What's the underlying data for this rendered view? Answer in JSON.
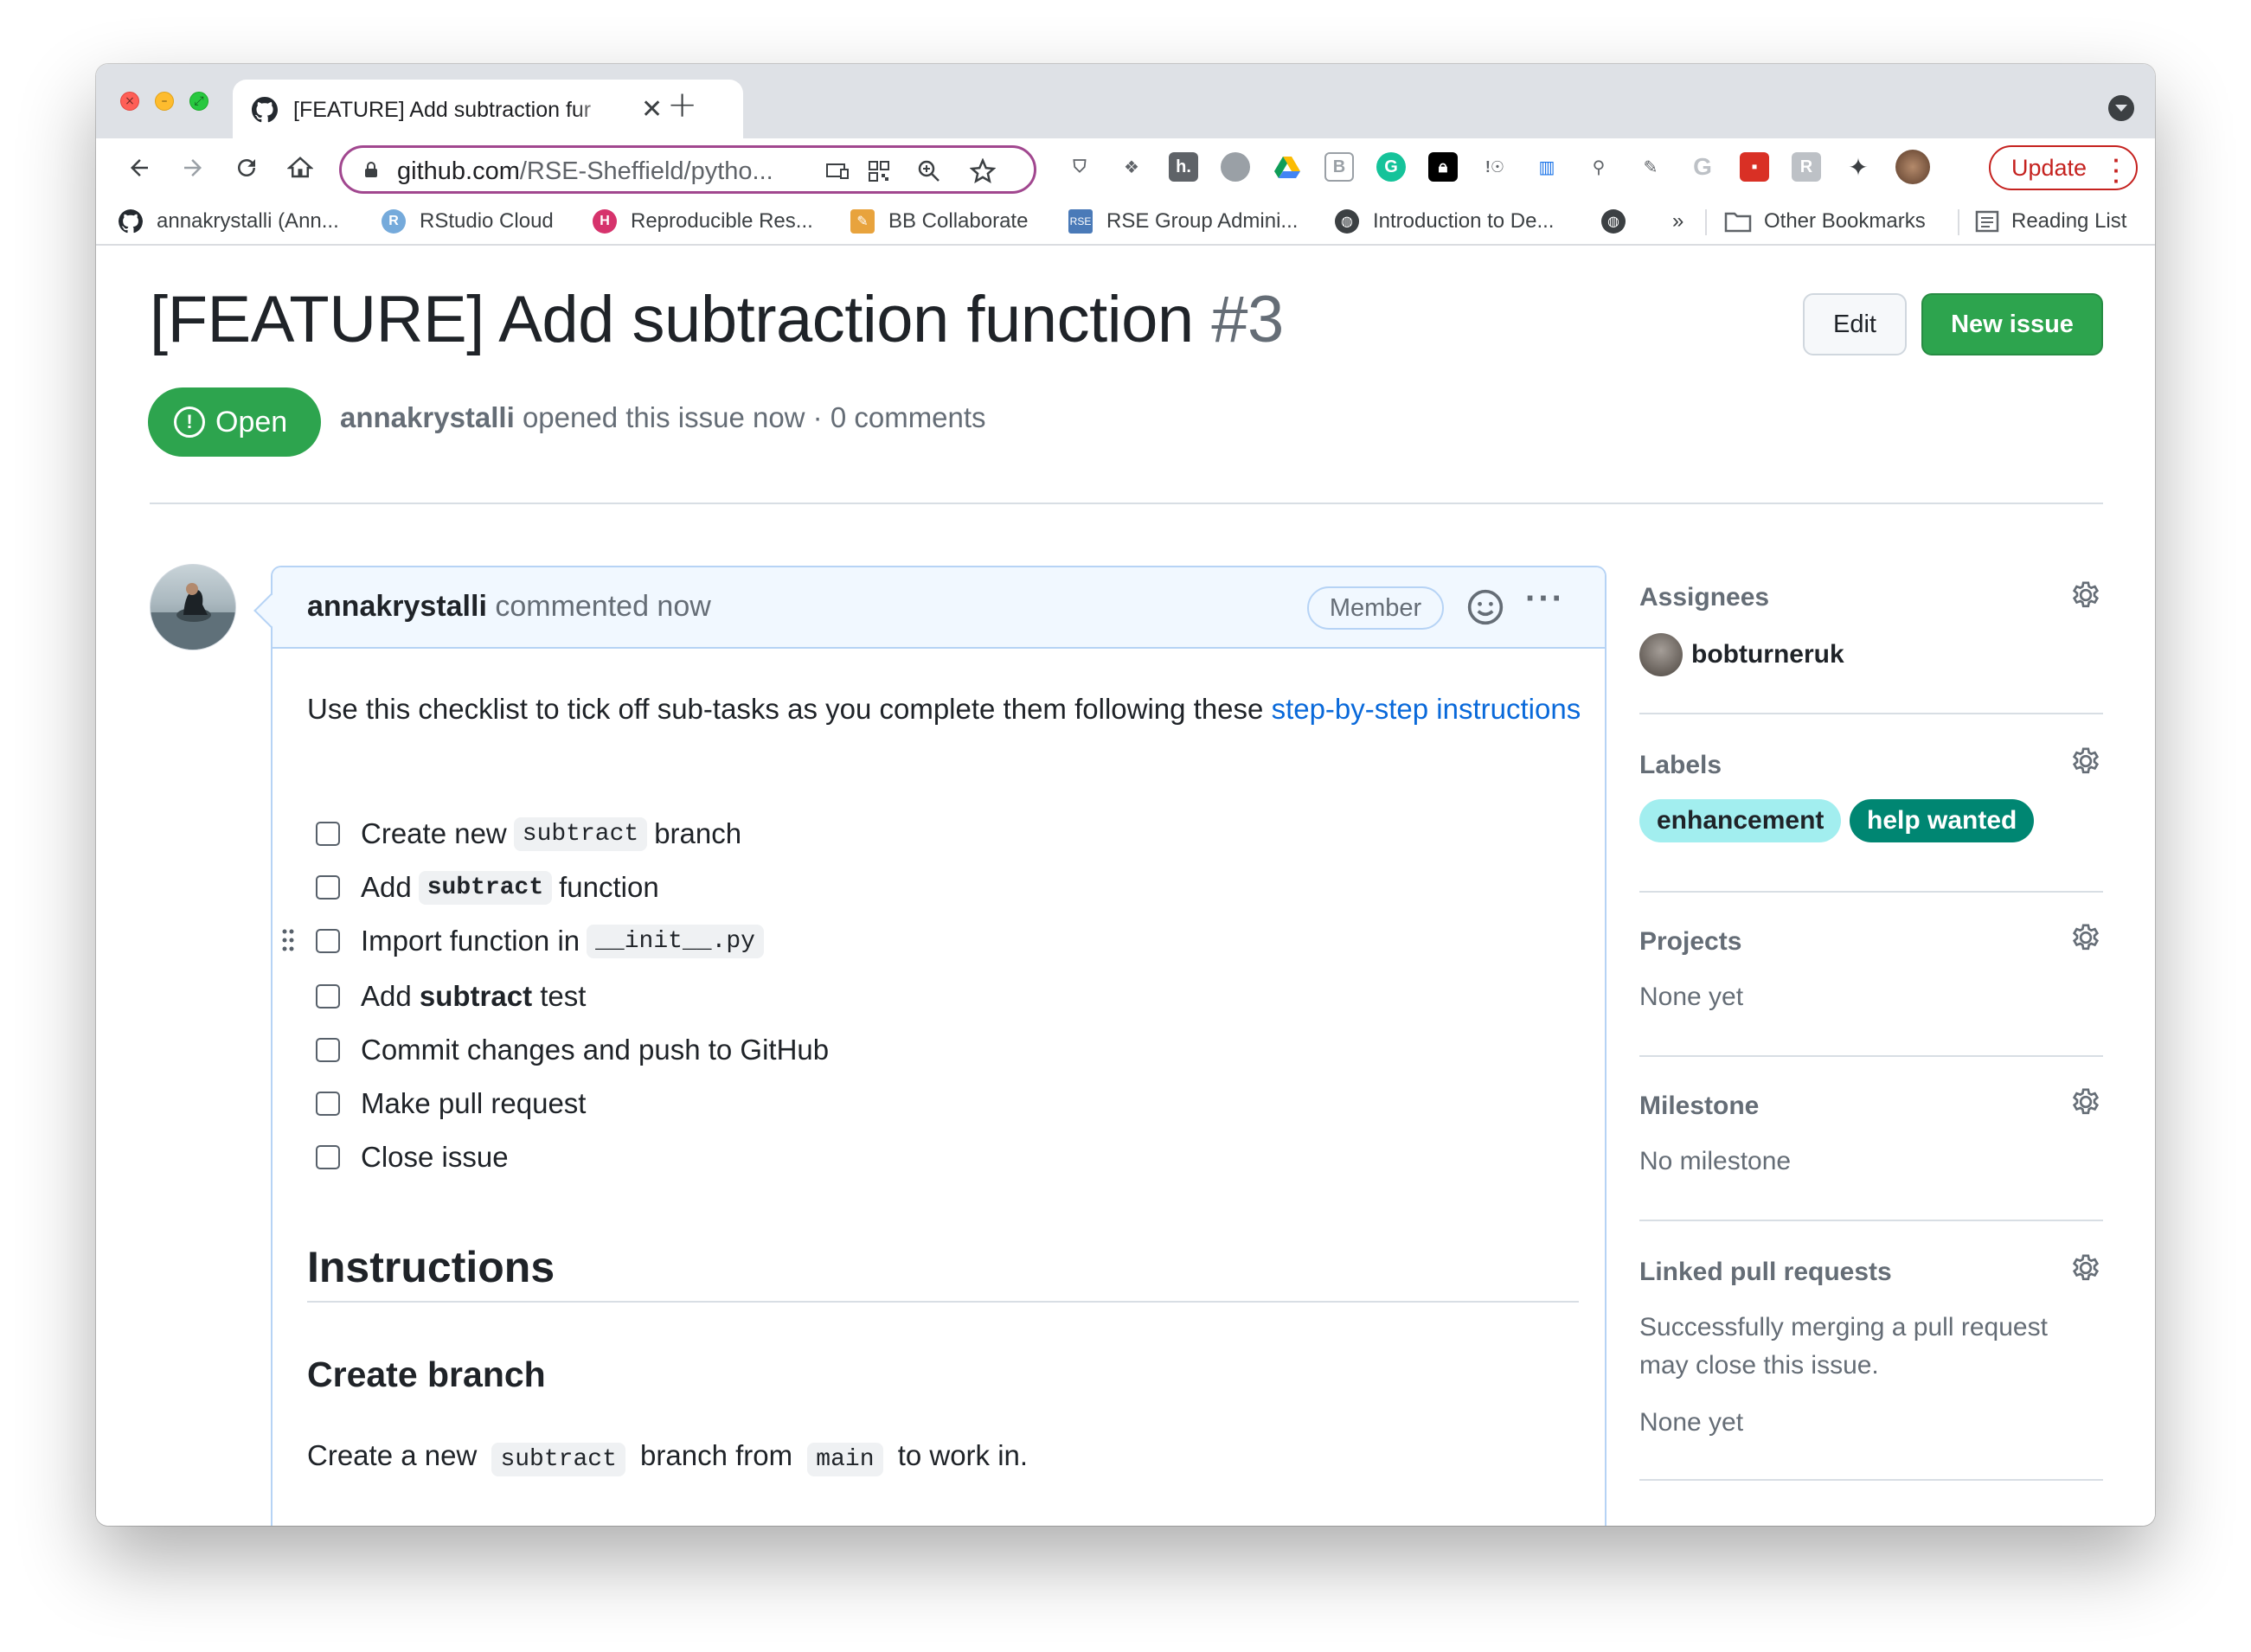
{
  "browser": {
    "tab_title": "[FEATURE] Add subtraction fur",
    "tab_close": "✕",
    "new_tab": "+",
    "url_host": "github.com",
    "url_path": "/RSE-Sheffield/pytho...",
    "update_label": "Update",
    "bookmarks": [
      {
        "label": "annakrystalli (Ann...",
        "icon": "github-icon"
      },
      {
        "label": "RStudio Cloud",
        "icon": "rstudio-icon"
      },
      {
        "label": "Reproducible Res...",
        "icon": "hexagon-icon"
      },
      {
        "label": "BB Collaborate",
        "icon": "pencil-icon"
      },
      {
        "label": "RSE Group Admini...",
        "icon": "rse-icon"
      },
      {
        "label": "Introduction to De...",
        "icon": "globe-icon"
      }
    ],
    "bookmarks_overflow": "»",
    "other_bookmarks": "Other Bookmarks",
    "reading_list": "Reading List",
    "accent_color": "#a1478f"
  },
  "issue": {
    "title": "[FEATURE] Add subtraction function",
    "number": "#3",
    "edit_label": "Edit",
    "new_issue_label": "New issue",
    "state": "Open",
    "author": "annakrystalli",
    "meta_text": "opened this issue now · 0 comments",
    "green": "#2da44e"
  },
  "comment": {
    "author": "annakrystalli",
    "time": "commented now",
    "role": "Member",
    "more": "···",
    "intro": "Use this checklist to tick off sub-tasks as you complete them following these ",
    "intro_link": "step-by-step instructions",
    "tasks": [
      {
        "pre": "Create new",
        "code": "subtract",
        "post": "branch",
        "checked": false
      },
      {
        "pre": "Add",
        "code": "subtract",
        "post": "function",
        "checked": false
      },
      {
        "pre": "Import function in",
        "code": "__init__.py",
        "post": "",
        "checked": false
      },
      {
        "pre": "Add ",
        "bold": "subtract",
        "post": " test",
        "checked": false
      },
      {
        "pre": "Commit changes and push to GitHub",
        "checked": false
      },
      {
        "pre": "Make pull request",
        "checked": false
      },
      {
        "pre": "Close issue",
        "checked": false
      }
    ],
    "heading": "Instructions",
    "subheading": "Create branch",
    "last_pre": "Create a new",
    "last_code1": "subtract",
    "last_mid": "branch from",
    "last_code2": "main",
    "last_post": "to work in."
  },
  "sidebar": {
    "assignees_title": "Assignees",
    "assignee": "bobturneruk",
    "labels_title": "Labels",
    "labels": [
      {
        "name": "enhancement",
        "bg": "#a2eeef",
        "fg": "#1f2328"
      },
      {
        "name": "help wanted",
        "bg": "#008672",
        "fg": "#ffffff"
      }
    ],
    "projects_title": "Projects",
    "projects_value": "None yet",
    "milestone_title": "Milestone",
    "milestone_value": "No milestone",
    "linked_title": "Linked pull requests",
    "linked_desc_1": "Successfully merging a pull request",
    "linked_desc_2": "may close this issue.",
    "linked_value": "None yet"
  }
}
